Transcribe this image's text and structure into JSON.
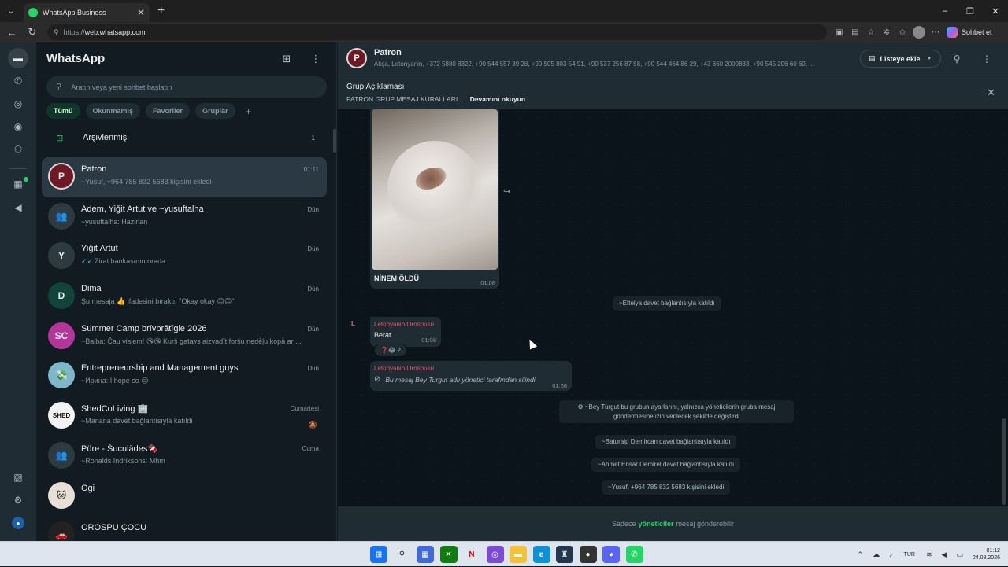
{
  "browser": {
    "tab_title": "WhatsApp Business",
    "url_proto": "https://",
    "url_host": "web.whatsapp.com",
    "copilot_label": "Sohbet et"
  },
  "sidebar": {
    "title": "WhatsApp",
    "search_placeholder": "Aratın veya yeni sohbet başlatın",
    "filters": [
      "Tümü",
      "Okunmamış",
      "Favoriler",
      "Gruplar"
    ],
    "archived_label": "Arşivlenmiş",
    "archived_count": "1",
    "chats": [
      {
        "name": "Patron",
        "message": "~Yusuf, +964 785 832 5683 kişisini ekledi",
        "time": "01:11",
        "avatar_text": "P",
        "avatar_color": "#6d1a24"
      },
      {
        "name": "Adem, Yiğit Artut ve ~yusuftalha",
        "message": "~yusuftalha: Hazirlan",
        "time": "Dün",
        "avatar_text": "👥",
        "avatar_color": "#2d3a40"
      },
      {
        "name": "Yiğit Artut",
        "message": "Zirat bankasının orada",
        "time": "Dün",
        "avatar_text": "Y",
        "avatar_color": "#2d3a40",
        "tick": "✓✓"
      },
      {
        "name": "Dima",
        "message": "Şu mesaja 👍 ifadesini bıraktı: \"Okay okay 😊😊\"",
        "time": "Dün",
        "avatar_text": "D",
        "avatar_color": "#11443a"
      },
      {
        "name": "Summer Camp brīvprātīgie 2026",
        "message": "~Baiba: Čau visiem! 😘😘 Kurš gatavs aizvadīt foršu nedēļu kopā ar ...",
        "time": "Dün",
        "avatar_text": "SC",
        "avatar_color": "#b5369a"
      },
      {
        "name": "Entrepreneurship and Management guys",
        "message": "~Ирина: I hope so 😔",
        "time": "Dün",
        "avatar_text": "💸",
        "avatar_color": "#7fb7c9"
      },
      {
        "name": "ShedCoLiving 🏢",
        "message": "~Mariana davet bağlantısıyla katıldı",
        "time": "Cumartesi",
        "avatar_text": "SHED",
        "avatar_color": "#f2f2f2",
        "muted": true
      },
      {
        "name": "Püre - Šuculādes🍫",
        "message": "~Ronalds Indriksons: Mhm",
        "time": "Cuma",
        "avatar_text": "👥",
        "avatar_color": "#2d3a40"
      },
      {
        "name": "Ogi",
        "message": "",
        "time": "",
        "avatar_text": "🐱",
        "avatar_color": "#e8e0d6"
      },
      {
        "name": "OROSPU ÇOCU",
        "message": "",
        "time": "",
        "avatar_text": "🚗",
        "avatar_color": "#222"
      }
    ]
  },
  "conversation": {
    "title": "Patron",
    "subtitle": "Akça, Letonyanin, +372 5880 8322, +90 544 557 39 28, +90 505 803 54 91, +90 537 256 87 58, +90 544 464 86 29, +43 660 2000833, +90 545 206 60 60, ...",
    "list_add_label": "Listeye ekle",
    "desc_title": "Grup Açıklaması",
    "desc_text": "PATRON GRUP MESAJ KURALLARI...",
    "desc_more": "Devamını okuyun",
    "image_caption": "NİNEM ÖLDÜ",
    "image_time": "01:08",
    "sys1": "~Eftelya davet bağlantısıyla katıldı",
    "sender_initial": "L",
    "msg1_sender": "Letonyanin Orospusu",
    "msg1_text": "Berat",
    "msg1_time": "01:08",
    "msg1_reactions": "❓😂 2",
    "msg2_sender": "Letonyanin Orospusu",
    "msg2_text": "Bu mesaj Bey Turgut adlı yönetici tarafından silindi",
    "msg2_time": "01:08",
    "sys2": "⚙ ~Bey Turgut bu grubun ayarlarını, yalnızca yöneticilerin gruba mesaj göndermesine izin verilecek şekilde değiştirdi",
    "sys3": "~Baturalp Demircan davet bağlantısıyla katıldı",
    "sys4": "~Ahmet Ensar Demirel davet bağlantısıyla katıldı",
    "sys5": "~Yusuf, +964 785 832 5683 kişisini ekledi",
    "footer_pre": "Sadece",
    "footer_admins": "yöneticiler",
    "footer_post": "mesaj gönderebilir"
  },
  "taskbar": {
    "lang": "TUR",
    "time": "01:12",
    "date": "24.08.2026"
  }
}
